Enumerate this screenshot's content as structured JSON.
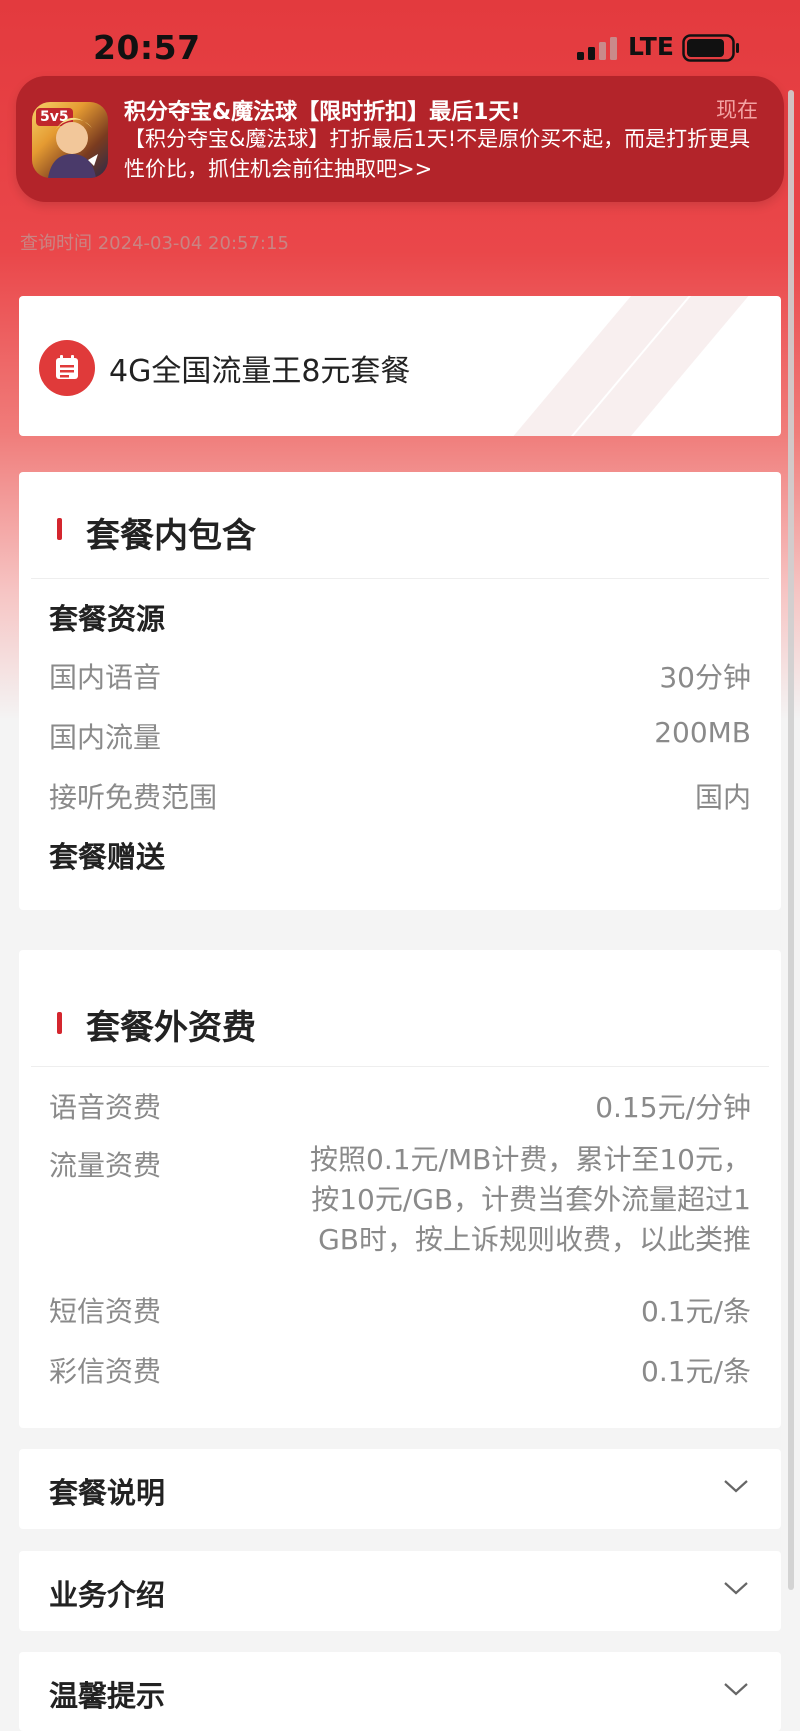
{
  "status_bar": {
    "time": "20:57",
    "network": "LTE"
  },
  "notification": {
    "title": "积分夺宝&魔法球【限时折扣】最后1天!",
    "time": "现在",
    "body": "【积分夺宝&魔法球】打折最后1天!不是原价买不起，而是打折更具性价比，抓住机会前往抽取吧>>",
    "app_icon_badge": "5v5",
    "app_icon": "game-hero-icon"
  },
  "query_time": "查询时间 2024-03-04 20:57:15",
  "plan": {
    "name": "4G全国流量王8元套餐",
    "icon": "calendar-icon"
  },
  "included": {
    "title": "套餐内包含",
    "resources_label": "套餐资源",
    "items": [
      {
        "label": "国内语音",
        "value": "30分钟"
      },
      {
        "label": "国内流量",
        "value": "200MB"
      },
      {
        "label": "接听免费范围",
        "value": "国内"
      }
    ],
    "gift_label": "套餐赠送"
  },
  "extra": {
    "title": "套餐外资费",
    "voice": {
      "label": "语音资费",
      "value": "0.15元/分钟"
    },
    "data": {
      "label": "流量资费",
      "lines": [
        "按照0.1元/MB计费，累计至10元，",
        "按10元/GB，计费当套外流量超过1",
        "GB时，按上诉规则收费，以此类推"
      ]
    },
    "sms": {
      "label": "短信资费",
      "value": "0.1元/条"
    },
    "mms": {
      "label": "彩信资费",
      "value": "0.1元/条"
    }
  },
  "accordions": [
    {
      "label": "套餐说明"
    },
    {
      "label": "业务介绍"
    },
    {
      "label": "温馨提示"
    }
  ],
  "colors": {
    "brand_red": "#d4262e",
    "notif_bg": "#b3242a"
  }
}
